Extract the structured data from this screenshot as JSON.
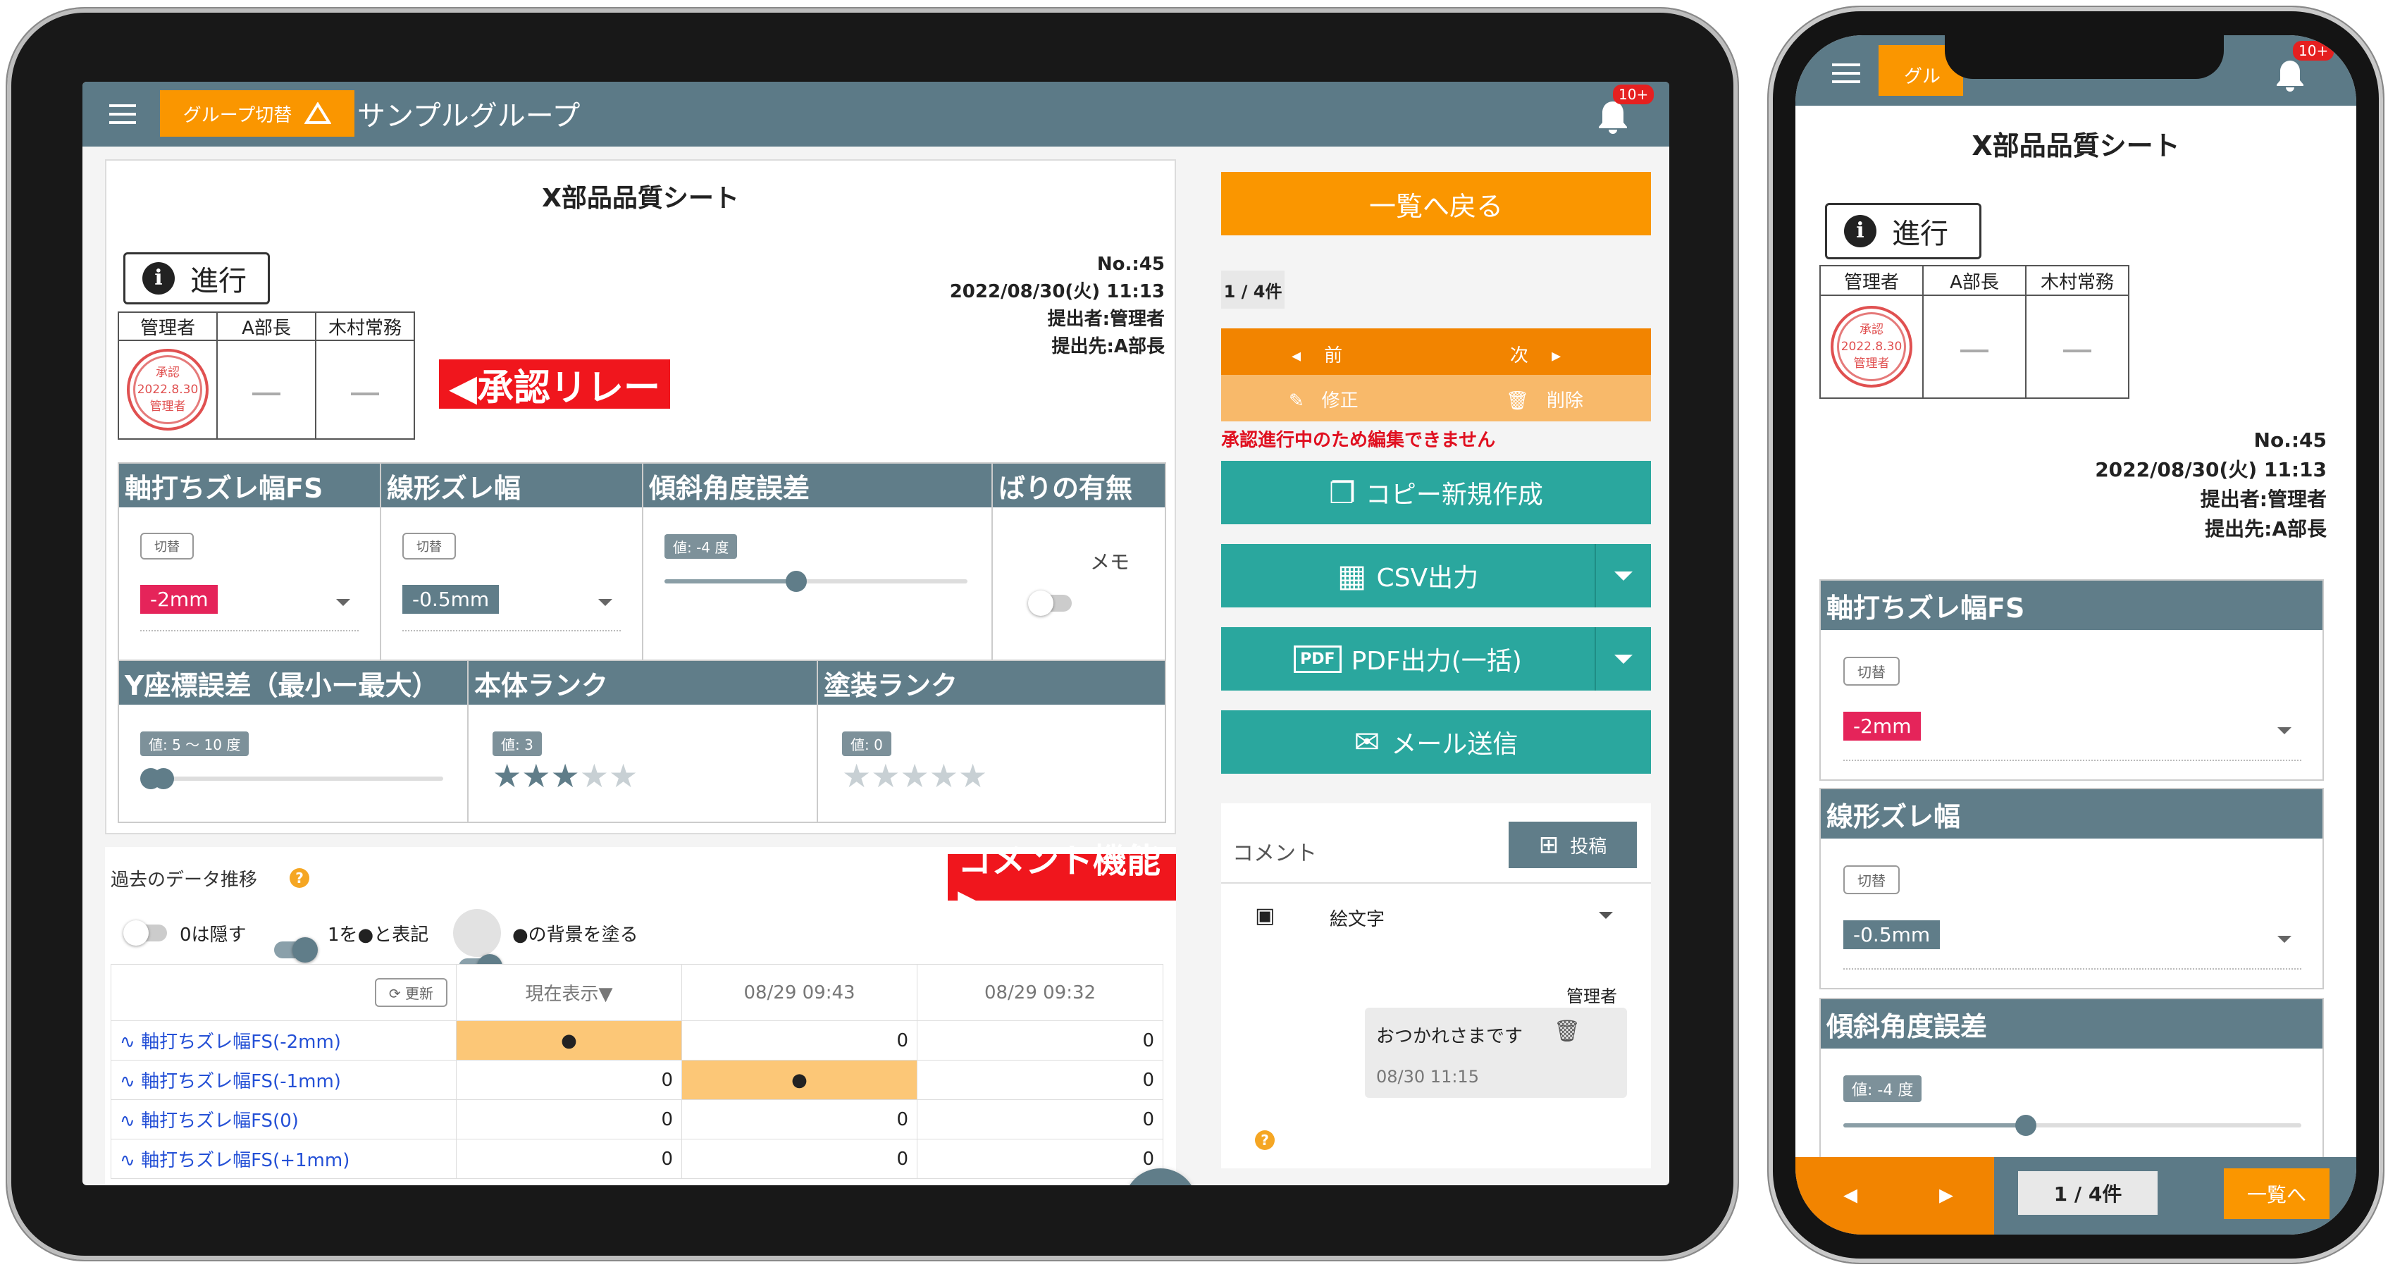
{
  "colors": {
    "header": "#5c7a87",
    "orange": "#fa9600",
    "teal": "#2aa79e",
    "slate": "#607d89",
    "red": "#f0161d"
  },
  "ipad": {
    "header": {
      "group_button": "グループ切替",
      "group_name": "サンプルグループ",
      "badge": "10+"
    },
    "sheet": {
      "title": "X部品品質シート",
      "progress_label": "進行",
      "approvers": [
        "管理者",
        "A部長",
        "木村常務"
      ],
      "stamp": {
        "top": "承認",
        "date": "2022.8.30",
        "bottom": "管理者"
      },
      "no": "No.:45",
      "datetime": "2022/08/30(火) 11:13",
      "submitter": "提出者:管理者",
      "recipient": "提出先:A部長",
      "relay_banner": "◀承認リレー",
      "fields": [
        {
          "label": "軸打ちズレ幅FS",
          "chip": "切替",
          "value": "-2mm"
        },
        {
          "label": "線形ズレ幅",
          "chip": "切替",
          "value": "-0.5mm"
        },
        {
          "label": "傾斜角度誤差",
          "value_tag": "値: -4 度",
          "slider_fraction": 0.4
        },
        {
          "label": "ばりの有無",
          "toggle_label": "メモ"
        },
        {
          "label": "Y座標誤差（最小ー最大）",
          "value_tag": "値: 5 〜 10 度"
        },
        {
          "label": "本体ランク",
          "value_tag": "値: 3",
          "stars": 3
        },
        {
          "label": "塗装ランク",
          "value_tag": "値: 0",
          "stars": 0
        }
      ]
    },
    "history": {
      "title": "過去のデータ推移",
      "help": "?",
      "comment_banner": "コメント機能▶",
      "toggles": [
        "0は隠す",
        "1を●と表記",
        "●の背景を塗る"
      ],
      "refresh": "更新",
      "columns": [
        "現在表示▼",
        "08/29 09:43",
        "08/29 09:32"
      ],
      "rows": [
        {
          "label": "軸打ちズレ幅FS(-2mm)",
          "cells": [
            "●",
            "0",
            "0"
          ]
        },
        {
          "label": "軸打ちズレ幅FS(-1mm)",
          "cells": [
            "0",
            "●",
            "0"
          ]
        },
        {
          "label": "軸打ちズレ幅FS(0)",
          "cells": [
            "0",
            "0",
            "0"
          ]
        },
        {
          "label": "軸打ちズレ幅FS(+1mm)",
          "cells": [
            "0",
            "0",
            "0"
          ]
        }
      ]
    },
    "side": {
      "back": "一覧へ戻る",
      "pager": "1 / 4件",
      "prev": "前",
      "next": "次",
      "edit": "修正",
      "delete": "削除",
      "warning": "承認進行中のため編集できません",
      "copy": "コピー新規作成",
      "csv": "CSV出力",
      "pdf": "PDF出力(一括)",
      "mail": "メール送信",
      "comment_label": "コメント",
      "post": "投稿",
      "emoji": "絵文字",
      "comment_user": "管理者",
      "comment_text": "おつかれさまです",
      "comment_time": "08/30 11:15",
      "help": "?"
    }
  },
  "iphone": {
    "header": {
      "group_button": "グル",
      "badge": "10+"
    },
    "title": "X部品品質シート",
    "progress_label": "進行",
    "approvers": [
      "管理者",
      "A部長",
      "木村常務"
    ],
    "stamp": {
      "top": "承認",
      "date": "2022.8.30",
      "bottom": "管理者"
    },
    "no": "No.:45",
    "datetime": "2022/08/30(火) 11:13",
    "submitter": "提出者:管理者",
    "recipient": "提出先:A部長",
    "fields": [
      {
        "label": "軸打ちズレ幅FS",
        "chip": "切替",
        "value": "-2mm"
      },
      {
        "label": "線形ズレ幅",
        "chip": "切替",
        "value": "-0.5mm"
      },
      {
        "label": "傾斜角度誤差",
        "value_tag": "値: -4 度",
        "slider_fraction": 0.4
      }
    ],
    "footer": {
      "pager": "1 / 4件",
      "back": "一覧へ"
    }
  }
}
